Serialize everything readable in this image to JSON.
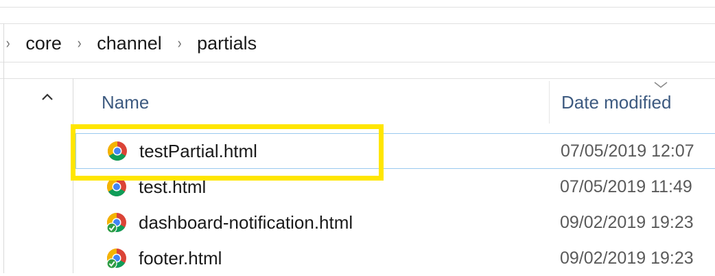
{
  "breadcrumb": {
    "items": [
      "core",
      "channel",
      "partials"
    ]
  },
  "columns": {
    "name": "Name",
    "date_modified": "Date modified"
  },
  "files": [
    {
      "name": "testPartial.html",
      "date": "07/05/2019 12:07",
      "icon": "chrome-html-icon",
      "selected": true
    },
    {
      "name": "test.html",
      "date": "07/05/2019 11:49",
      "icon": "chrome-html-icon",
      "selected": false
    },
    {
      "name": "dashboard-notification.html",
      "date": "09/02/2019 19:23",
      "icon": "chrome-html-synced-icon",
      "selected": false
    },
    {
      "name": "footer.html",
      "date": "09/02/2019 19:23",
      "icon": "chrome-html-synced-icon",
      "selected": false
    }
  ],
  "colors": {
    "highlight": "#ffe600",
    "header_text": "#3d5a80",
    "selection_border": "#99c9ef"
  }
}
